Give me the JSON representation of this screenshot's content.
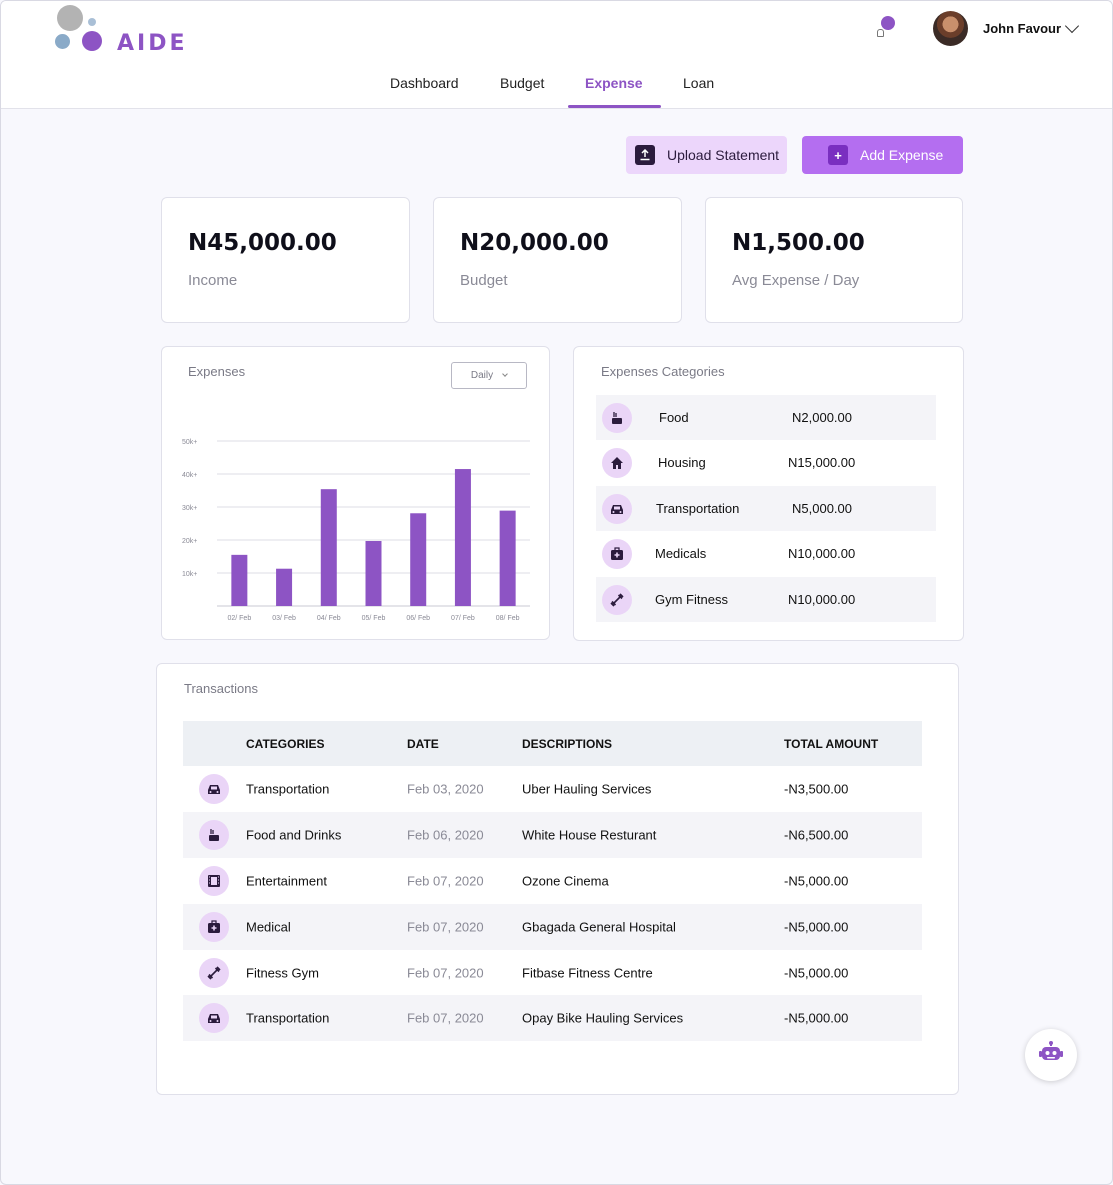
{
  "app": {
    "logo_text": "AIDE"
  },
  "header": {
    "user_name": "John Favour",
    "nav": [
      "Dashboard",
      "Budget",
      "Expense",
      "Loan"
    ],
    "active_nav": "Expense"
  },
  "actions": {
    "upload_label": "Upload Statement",
    "add_label": "Add Expense"
  },
  "stats": [
    {
      "value": "N45,000.00",
      "label": "Income"
    },
    {
      "value": "N20,000.00",
      "label": "Budget"
    },
    {
      "value": "N1,500.00",
      "label": "Avg Expense / Day"
    }
  ],
  "expenses_card": {
    "title": "Expenses",
    "period": "Daily"
  },
  "chart_data": {
    "type": "bar",
    "categories": [
      "02/ Feb",
      "03/ Feb",
      "04/ Feb",
      "05/ Feb",
      "06/ Feb",
      "07/ Feb",
      "08/ Feb"
    ],
    "values": [
      15500,
      11300,
      35400,
      19700,
      28100,
      41500,
      28900
    ],
    "ytick_labels": [
      "10k+",
      "20k+",
      "30k+",
      "40k+",
      "50k+"
    ],
    "ytick_values": [
      10000,
      20000,
      30000,
      40000,
      50000
    ],
    "ylim": [
      0,
      50000
    ],
    "grid": true,
    "bar_color": "#8d54c4"
  },
  "categories_card": {
    "title": "Expenses Categories",
    "items": [
      {
        "icon": "food-icon",
        "name": "Food",
        "amount": "N2,000.00"
      },
      {
        "icon": "house-icon",
        "name": "Housing",
        "amount": "N15,000.00"
      },
      {
        "icon": "car-icon",
        "name": "Transportation",
        "amount": "N5,000.00"
      },
      {
        "icon": "medical-kit-icon",
        "name": "Medicals",
        "amount": "N10,000.00"
      },
      {
        "icon": "dumbbell-icon",
        "name": "Gym Fitness",
        "amount": "N10,000.00"
      }
    ]
  },
  "transactions": {
    "title": "Transactions",
    "headers": [
      "CATEGORIES",
      "DATE",
      "DESCRIPTIONS",
      "TOTAL AMOUNT"
    ],
    "rows": [
      {
        "icon": "car-icon",
        "category": "Transportation",
        "date": "Feb 03, 2020",
        "description": "Uber Hauling Services",
        "amount": "-N3,500.00"
      },
      {
        "icon": "food-icon",
        "category": "Food and Drinks",
        "date": "Feb 06, 2020",
        "description": "White House Resturant",
        "amount": "-N6,500.00"
      },
      {
        "icon": "film-icon",
        "category": "Entertainment",
        "date": "Feb 07, 2020",
        "description": "Ozone Cinema",
        "amount": "-N5,000.00"
      },
      {
        "icon": "medical-kit-icon",
        "category": "Medical",
        "date": "Feb 07, 2020",
        "description": "Gbagada General Hospital",
        "amount": "-N5,000.00"
      },
      {
        "icon": "dumbbell-icon",
        "category": "Fitness Gym",
        "date": "Feb 07, 2020",
        "description": "Fitbase Fitness Centre",
        "amount": "-N5,000.00"
      },
      {
        "icon": "car-icon",
        "category": "Transportation",
        "date": "Feb 07, 2020",
        "description": "Opay Bike Hauling Services",
        "amount": "-N5,000.00"
      }
    ]
  },
  "colors": {
    "accent": "#8d54c4",
    "button_primary": "#b46ef0",
    "button_secondary": "#ecd6fb",
    "icon_bg": "#ead5f7"
  }
}
